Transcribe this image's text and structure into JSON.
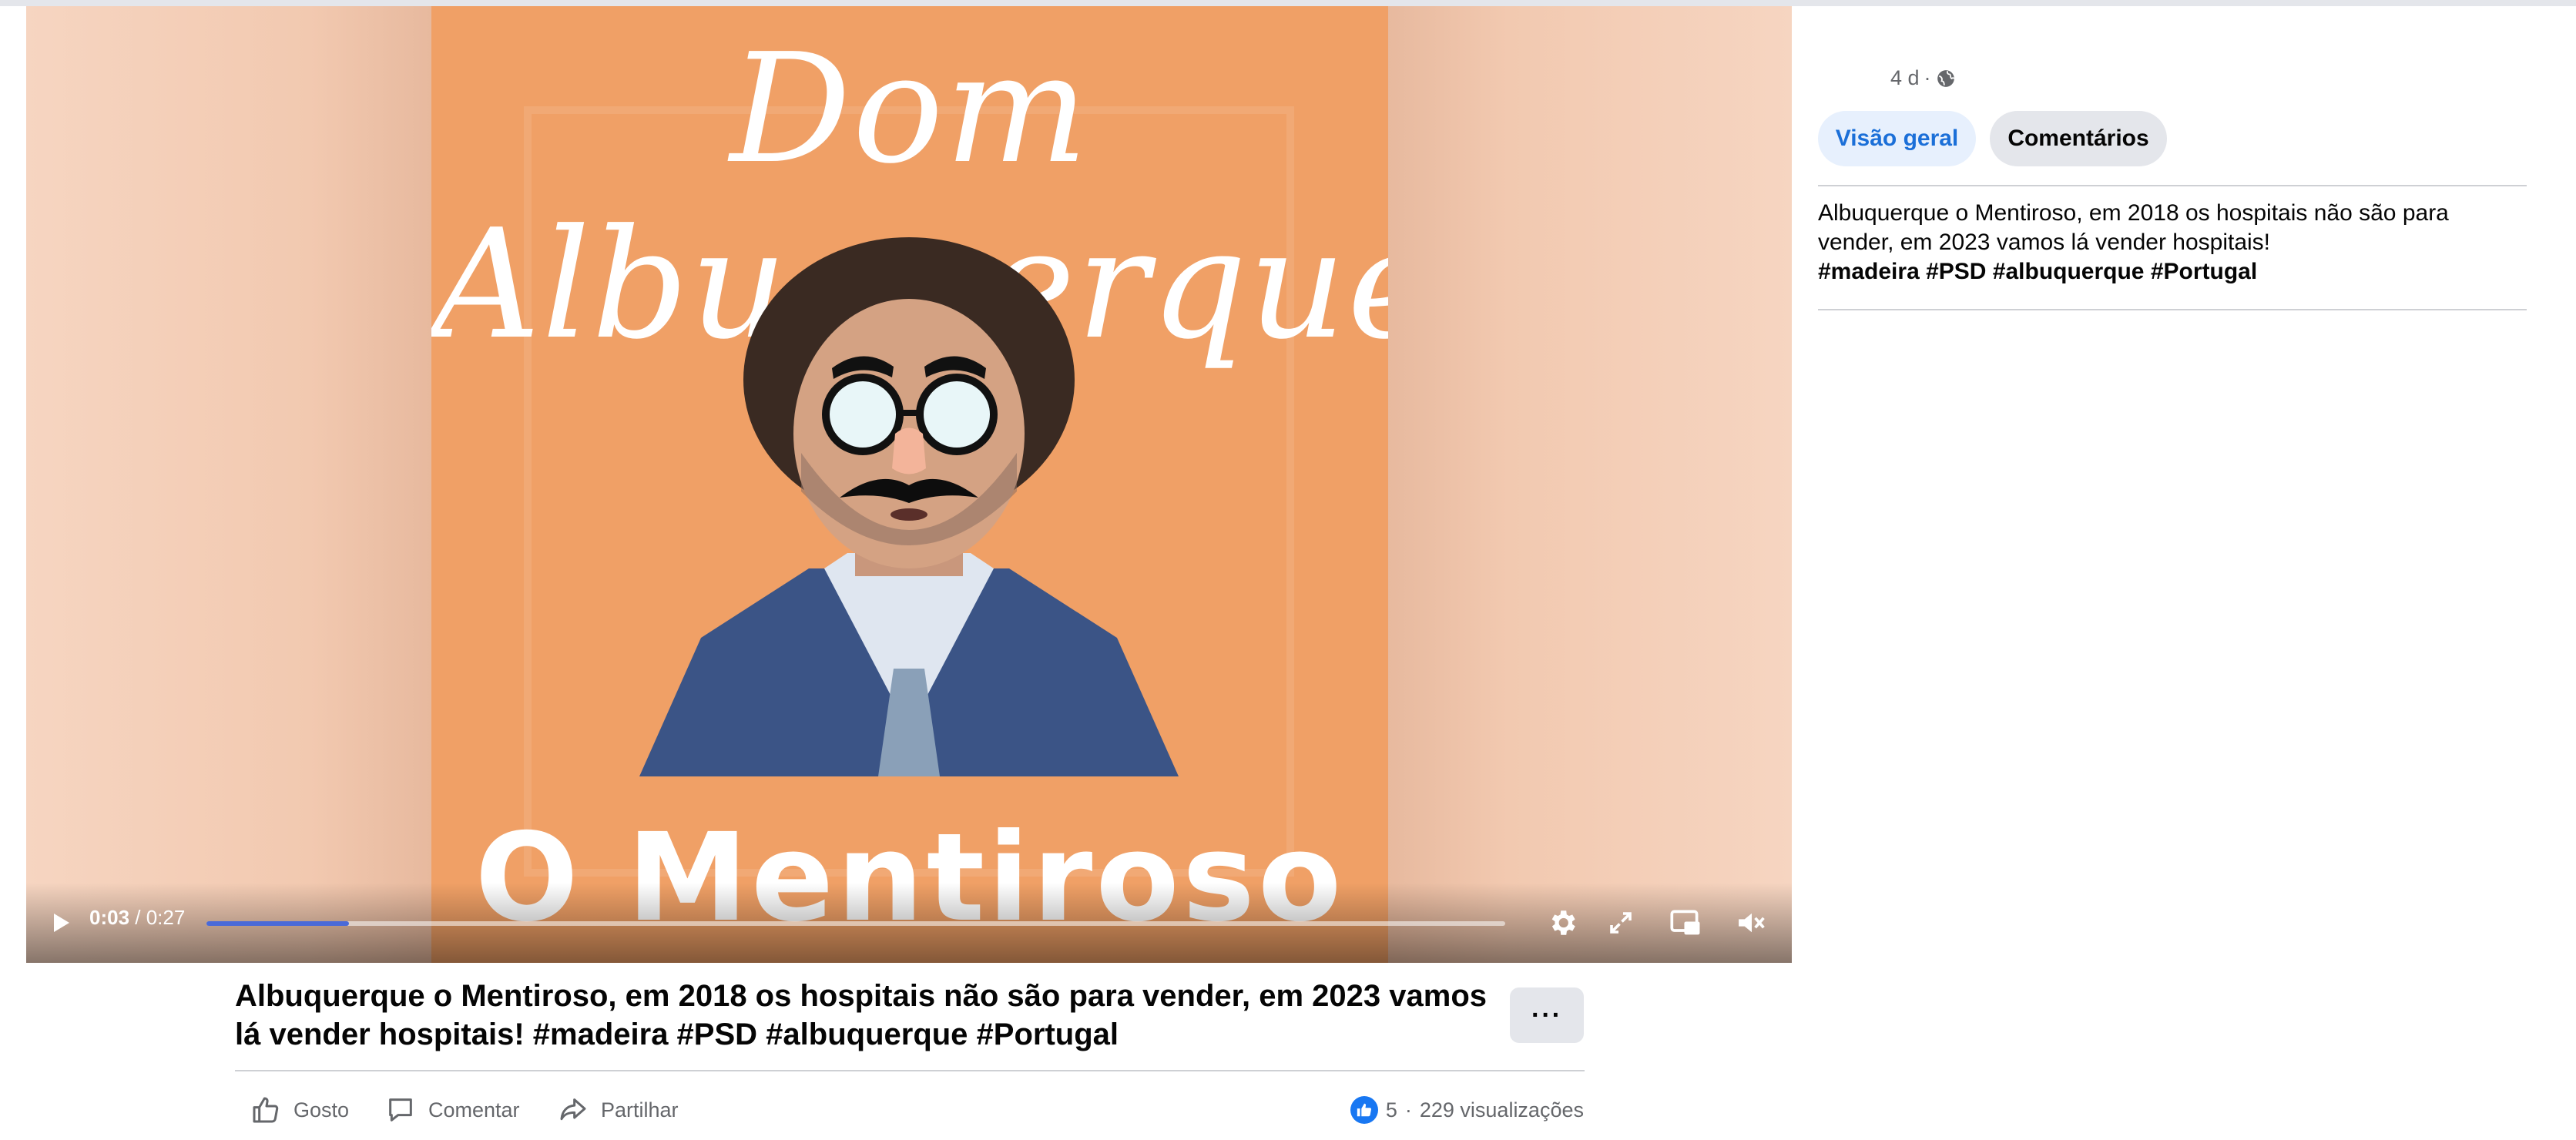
{
  "video": {
    "poster_title": "Dom Albuquerque",
    "poster_subtitle": "O Mentiroso",
    "time_current": "0:03",
    "time_separator": " / ",
    "time_total": "0:27",
    "progress_fraction": 0.11,
    "progress_color": "#4a6ad8",
    "icons": [
      "play-icon",
      "settings-gear-icon",
      "fullscreen-icon",
      "picture-in-picture-icon",
      "muted-speaker-icon"
    ]
  },
  "post": {
    "title_line1": "Albuquerque o Mentiroso, em 2018 os hospitais não são para vender, em 2023 vamos",
    "title_line2": "lá vender hospitais! #madeira #PSD #albuquerque #Portugal",
    "more_label": "···",
    "actions": {
      "like": "Gosto",
      "comment": "Comentar",
      "share": "Partilhar"
    },
    "stats": {
      "reactions": "5",
      "dot": "·",
      "views": "229 visualizações"
    }
  },
  "panel": {
    "age": "4 d",
    "dot": "·",
    "audience_icon": "globe-icon",
    "tabs": [
      {
        "label": "Visão geral",
        "active": true
      },
      {
        "label": "Comentários",
        "active": false
      }
    ],
    "description_line1": "Albuquerque o Mentiroso, em 2018 os hospitais não são para",
    "description_line2": "vender, em 2023 vamos lá vender hospitais!",
    "hashtags": "#madeira #PSD #albuquerque #Portugal"
  },
  "colors": {
    "poster_background": "#f0a066",
    "blur_background": "#f5d2bd",
    "accent_blue": "#1b6fd8",
    "active_tab_bg": "#e7f0fd",
    "secondary_text": "#65676b"
  }
}
